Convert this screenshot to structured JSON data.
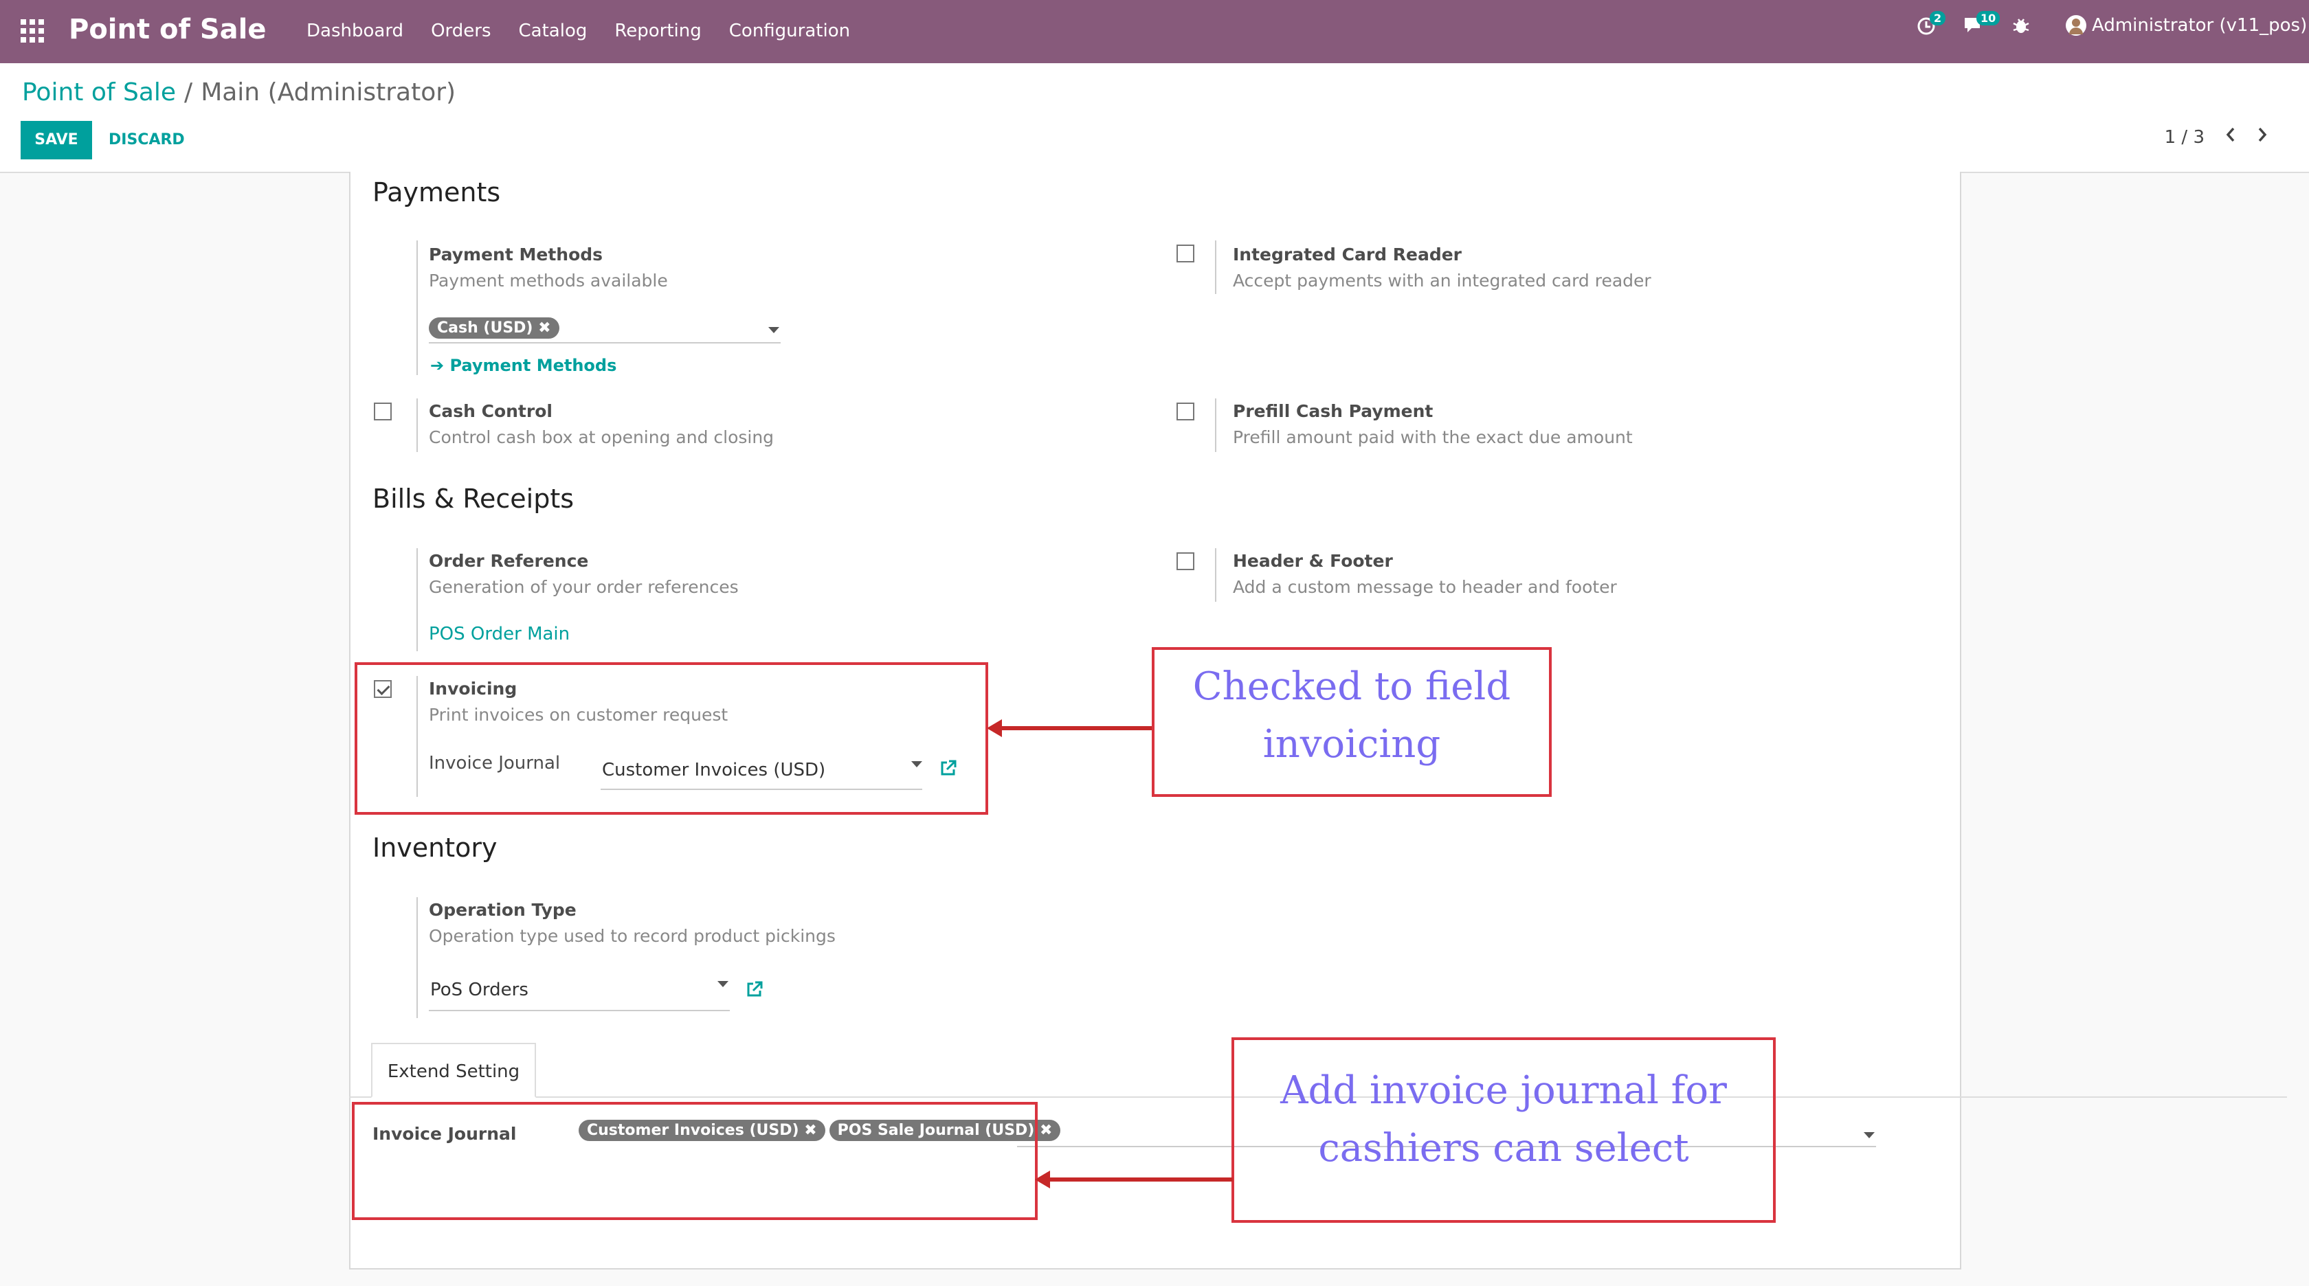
{
  "topbar": {
    "app_name": "Point of Sale",
    "menu": [
      "Dashboard",
      "Orders",
      "Catalog",
      "Reporting",
      "Configuration"
    ],
    "activity_count": "2",
    "messages_count": "10",
    "user": "Administrator (v11_pos)"
  },
  "control_panel": {
    "breadcrumb_root": "Point of Sale",
    "breadcrumb_sep": "/",
    "breadcrumb_current": "Main (Administrator)",
    "save_label": "SAVE",
    "discard_label": "DISCARD",
    "pager": "1 / 3"
  },
  "payments": {
    "heading": "Payments",
    "payment_methods_title": "Payment Methods",
    "payment_methods_desc": "Payment methods available",
    "payment_method_tag": "Cash (USD)",
    "payment_methods_link": "Payment Methods",
    "card_reader_title": "Integrated Card Reader",
    "card_reader_desc": "Accept payments with an integrated card reader",
    "cash_control_title": "Cash Control",
    "cash_control_desc": "Control cash box at opening and closing",
    "prefill_title": "Prefill Cash Payment",
    "prefill_desc": "Prefill amount paid with the exact due amount"
  },
  "bills": {
    "heading": "Bills & Receipts",
    "order_ref_title": "Order Reference",
    "order_ref_desc": "Generation of your order references",
    "order_ref_value": "POS Order Main",
    "header_footer_title": "Header & Footer",
    "header_footer_desc": "Add a custom message to header and footer",
    "invoicing_title": "Invoicing",
    "invoicing_desc": "Print invoices on customer request",
    "invoicing_checked": true,
    "invoice_journal_label": "Invoice Journal",
    "invoice_journal_value": "Customer Invoices (USD)"
  },
  "inventory": {
    "heading": "Inventory",
    "operation_type_title": "Operation Type",
    "operation_type_desc": "Operation type used to record product pickings",
    "operation_type_value": "PoS Orders"
  },
  "extend": {
    "tab_label": "Extend Setting",
    "invoice_journal_label": "Invoice Journal",
    "tags": [
      "Customer Invoices (USD)",
      "POS Sale Journal (USD)"
    ]
  },
  "annotations": {
    "box1_line1": "Checked to field",
    "box1_line2": "invoicing",
    "box2_line1": "Add invoice journal for",
    "box2_line2": "cashiers can select"
  },
  "colors": {
    "brand": "#875a7b",
    "accent": "#00a09d",
    "annotation_red": "#d9343f",
    "annotation_text": "#7a6cf0"
  }
}
